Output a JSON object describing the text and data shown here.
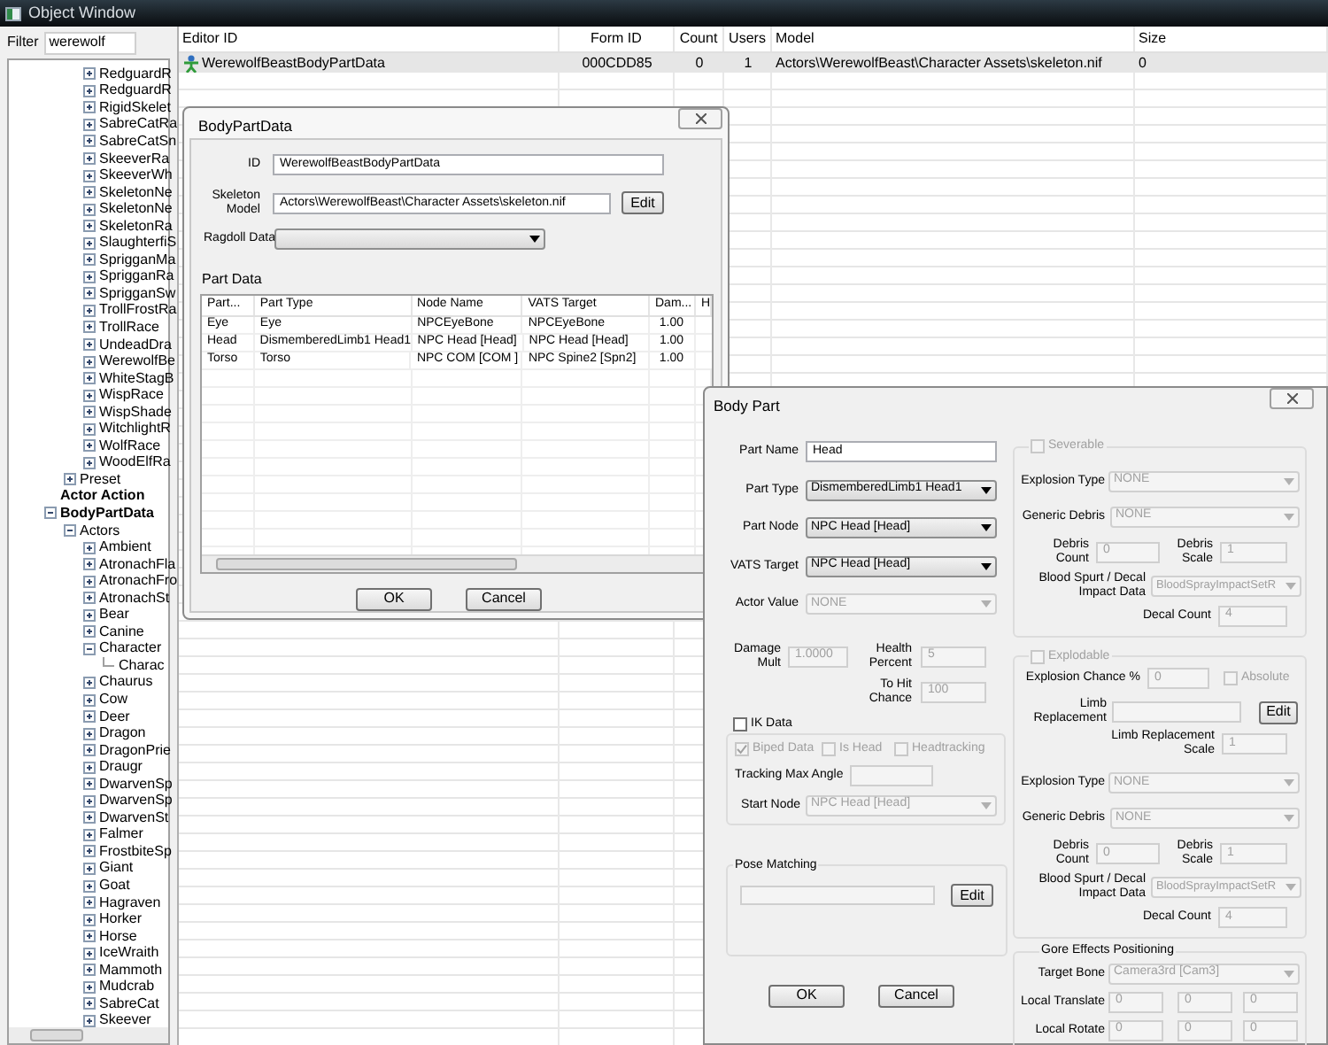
{
  "window": {
    "title": "Object Window"
  },
  "filter": {
    "label": "Filter",
    "value": "werewolf"
  },
  "tree": [
    {
      "children": [
        {
          "children": [
            {
              "label": "RedguardR",
              "expanded": false
            },
            {
              "label": "RedguardR",
              "expanded": false
            },
            {
              "label": "RigidSkelet",
              "expanded": false
            },
            {
              "label": "SabreCatRa",
              "expanded": false
            },
            {
              "label": "SabreCatSn",
              "expanded": false
            },
            {
              "label": "SkeeverRa",
              "expanded": false
            },
            {
              "label": "SkeeverWh",
              "expanded": false
            },
            {
              "label": "SkeletonNe",
              "expanded": false
            },
            {
              "label": "SkeletonNe",
              "expanded": false
            },
            {
              "label": "SkeletonRa",
              "expanded": false
            },
            {
              "label": "SlaughterfiS",
              "expanded": false
            },
            {
              "label": "SprigganMa",
              "expanded": false
            },
            {
              "label": "SprigganRa",
              "expanded": false
            },
            {
              "label": "SprigganSw",
              "expanded": false
            },
            {
              "label": "TrollFrostRa",
              "expanded": false
            },
            {
              "label": "TrollRace",
              "expanded": false
            },
            {
              "label": "UndeadDra",
              "expanded": false
            },
            {
              "label": "WerewolfBe",
              "expanded": false
            },
            {
              "label": "WhiteStagB",
              "expanded": false
            },
            {
              "label": "WispRace",
              "expanded": false
            },
            {
              "label": "WispShade",
              "expanded": false
            },
            {
              "label": "WitchlightR",
              "expanded": false
            },
            {
              "label": "WolfRace",
              "expanded": false
            },
            {
              "label": "WoodElfRa",
              "expanded": false
            }
          ]
        },
        {
          "label": "Preset",
          "expanded": false
        }
      ]
    },
    {
      "label": "Actor Action",
      "kind": "category"
    },
    {
      "label": "BodyPartData",
      "kind": "category",
      "expanded": true,
      "children": [
        {
          "label": "Actors",
          "expanded": true,
          "children": [
            {
              "label": "Ambient",
              "expanded": false
            },
            {
              "label": "AtronachFla",
              "expanded": false
            },
            {
              "label": "AtronachFro",
              "expanded": false
            },
            {
              "label": "AtronachSt",
              "expanded": false
            },
            {
              "label": "Bear",
              "expanded": false
            },
            {
              "label": "Canine",
              "expanded": false
            },
            {
              "label": "Character",
              "expanded": true,
              "children": [
                {
                  "label": "Charac"
                }
              ]
            },
            {
              "label": "Chaurus",
              "expanded": false
            },
            {
              "label": "Cow",
              "expanded": false
            },
            {
              "label": "Deer",
              "expanded": false
            },
            {
              "label": "Dragon",
              "expanded": false
            },
            {
              "label": "DragonPrie",
              "expanded": false
            },
            {
              "label": "Draugr",
              "expanded": false
            },
            {
              "label": "DwarvenSp",
              "expanded": false
            },
            {
              "label": "DwarvenSp",
              "expanded": false
            },
            {
              "label": "DwarvenSt",
              "expanded": false
            },
            {
              "label": "Falmer",
              "expanded": false
            },
            {
              "label": "FrostbiteSp",
              "expanded": false
            },
            {
              "label": "Giant",
              "expanded": false
            },
            {
              "label": "Goat",
              "expanded": false
            },
            {
              "label": "Hagraven",
              "expanded": false
            },
            {
              "label": "Horker",
              "expanded": false
            },
            {
              "label": "Horse",
              "expanded": false
            },
            {
              "label": "IceWraith",
              "expanded": false
            },
            {
              "label": "Mammoth",
              "expanded": false
            },
            {
              "label": "Mudcrab",
              "expanded": false
            },
            {
              "label": "SabreCat",
              "expanded": false
            },
            {
              "label": "Skeever",
              "expanded": false
            }
          ]
        }
      ]
    }
  ],
  "list": {
    "columns": [
      "Editor ID",
      "Form ID",
      "Count",
      "Users",
      "Model",
      "Size"
    ],
    "rows": [
      {
        "selected": true,
        "cells": [
          "WerewolfBeastBodyPartData",
          "000CDD85",
          "0",
          "1",
          "Actors\\WerewolfBeast\\Character Assets\\skeleton.nif",
          "0"
        ]
      }
    ]
  },
  "body_part_data": {
    "title": "BodyPartData",
    "id": {
      "label": "ID",
      "value": "WerewolfBeastBodyPartData"
    },
    "skeleton_model": {
      "label": "Skeleton Model",
      "value": "Actors\\WerewolfBeast\\Character Assets\\skeleton.nif",
      "button": "Edit"
    },
    "ragdoll_data": {
      "label": "Ragdoll Data"
    },
    "part_data": {
      "label": "Part Data",
      "columns": [
        "Part...",
        "Part Type",
        "Node Name",
        "VATS Target",
        "Dam...",
        "H"
      ],
      "rows": [
        [
          "Eye",
          "Eye",
          "NPCEyeBone",
          "NPCEyeBone",
          "1.00"
        ],
        [
          "Head",
          "DismemberedLimb1 Head1",
          "NPC Head [Head]",
          "NPC Head [Head]",
          "1.00"
        ],
        [
          "Torso",
          "Torso",
          "NPC COM [COM ]",
          "NPC Spine2 [Spn2]",
          "1.00"
        ]
      ]
    },
    "buttons": [
      "OK",
      "Cancel"
    ]
  },
  "body_part": {
    "title": "Body Part",
    "fields": [
      {
        "kind": "text",
        "label": "Part Name",
        "value": "Head",
        "disabled": false
      },
      {
        "kind": "dropdown",
        "label": "Part Type",
        "value": "DismemberedLimb1 Head1",
        "disabled": false
      },
      {
        "kind": "dropdown",
        "label": "Part Node",
        "value": "NPC Head [Head]",
        "disabled": false
      },
      {
        "kind": "dropdown",
        "label": "VATS Target",
        "value": "NPC Head [Head]",
        "disabled": false
      },
      {
        "kind": "dropdown",
        "label": "Actor Value",
        "value": "NONE",
        "disabled": true
      }
    ],
    "damage_mult": {
      "label": "Damage Mult",
      "value": "1.0000",
      "disabled": true
    },
    "health_percent": {
      "label": "Health Percent",
      "value": "5",
      "disabled": true
    },
    "to_hit_chance": {
      "label": "To Hit Chance",
      "value": "100",
      "disabled": true
    },
    "ik_data": {
      "label": "IK Data",
      "checked": false,
      "disabled": false,
      "options": [
        {
          "label": "Biped Data",
          "checked": true,
          "disabled": true
        },
        {
          "label": "Is Head",
          "checked": false,
          "disabled": true
        },
        {
          "label": "Headtracking",
          "checked": false,
          "disabled": true
        }
      ],
      "tracking_max_angle": {
        "label": "Tracking Max Angle",
        "disabled": true
      },
      "start_node": {
        "label": "Start Node",
        "value": "NPC Head [Head]",
        "disabled": true
      }
    },
    "pose_matching": {
      "title": "Pose Matching",
      "button": "Edit"
    },
    "buttons": [
      "OK",
      "Cancel"
    ],
    "severable": {
      "label": "Severable",
      "checked": false,
      "disabled": true,
      "explosion_type": {
        "label": "Explosion Type",
        "value": "NONE",
        "disabled": true
      },
      "generic_debris": {
        "label": "Generic Debris",
        "value": "NONE",
        "disabled": true
      },
      "debris_count": {
        "label": "Debris Count",
        "value": "0",
        "disabled": true
      },
      "debris_scale": {
        "label": "Debris Scale",
        "value": "1",
        "disabled": true
      },
      "blood_spurt": {
        "label": "Blood Spurt / Decal Impact Data",
        "value": "BloodSprayImpactSetR",
        "disabled": true
      },
      "decal_count": {
        "label": "Decal Count",
        "value": "4",
        "disabled": true
      }
    },
    "explodable": {
      "label": "Explodable",
      "checked": false,
      "disabled": true,
      "explosion_chance": {
        "label": "Explosion Chance %",
        "value": "0",
        "disabled": true
      },
      "absolute": {
        "label": "Absolute",
        "checked": false,
        "disabled": true
      },
      "limb_replacement": {
        "label": "Limb Replacement",
        "button": "Edit"
      },
      "limb_replacement_scale": {
        "label": "Limb Replacement Scale",
        "value": "1",
        "disabled": true
      },
      "explosion_type": {
        "label": "Explosion Type",
        "value": "NONE",
        "disabled": true
      },
      "generic_debris": {
        "label": "Generic Debris",
        "value": "NONE",
        "disabled": true
      },
      "debris_count": {
        "label": "Debris Count",
        "value": "0",
        "disabled": true
      },
      "debris_scale": {
        "label": "Debris Scale",
        "value": "1",
        "disabled": true
      },
      "blood_spurt": {
        "label": "Blood Spurt / Decal Impact Data",
        "value": "BloodSprayImpactSetR",
        "disabled": true
      },
      "decal_count": {
        "label": "Decal Count",
        "value": "4",
        "disabled": true
      }
    },
    "gore": {
      "title": "Gore Effects Positioning",
      "target_bone": {
        "label": "Target Bone",
        "value": "Camera3rd [Cam3]",
        "disabled": true
      },
      "local_translate": {
        "label": "Local Translate",
        "values": [
          "0",
          "0",
          "0"
        ],
        "disabled": true
      },
      "local_rotate": {
        "label": "Local Rotate",
        "values": [
          "0",
          "0",
          "0"
        ],
        "disabled": true
      }
    }
  }
}
